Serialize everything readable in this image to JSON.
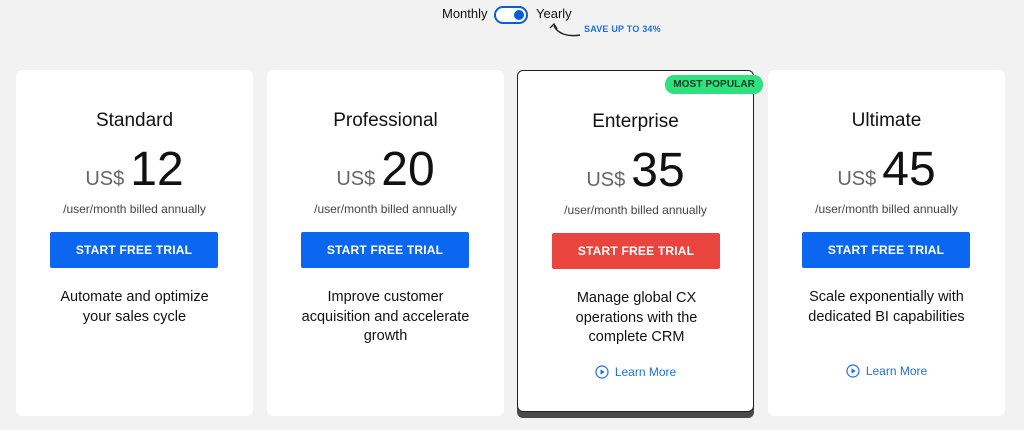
{
  "billing_toggle": {
    "monthly_label": "Monthly",
    "yearly_label": "Yearly",
    "selected": "Yearly",
    "save_note": "SAVE UP TO 34%"
  },
  "colors": {
    "accent_blue": "#0b66f0",
    "cta_red": "#e9443d",
    "badge_green": "#2ee27f"
  },
  "plans": [
    {
      "name": "Standard",
      "currency": "US$",
      "price": "12",
      "billing": "/user/month billed annually",
      "cta": "START FREE TRIAL",
      "description": "Automate and optimize your sales cycle"
    },
    {
      "name": "Professional",
      "currency": "US$",
      "price": "20",
      "billing": "/user/month billed annually",
      "cta": "START FREE TRIAL",
      "description": "Improve customer acquisition and accelerate growth"
    },
    {
      "name": "Enterprise",
      "badge": "MOST POPULAR",
      "currency": "US$",
      "price": "35",
      "billing": "/user/month billed annually",
      "cta": "START FREE TRIAL",
      "description": "Manage global CX operations with the complete CRM",
      "learn_more": "Learn More"
    },
    {
      "name": "Ultimate",
      "currency": "US$",
      "price": "45",
      "billing": "/user/month billed annually",
      "cta": "START FREE TRIAL",
      "description": "Scale exponentially with dedicated BI capabilities",
      "learn_more": "Learn More"
    }
  ]
}
